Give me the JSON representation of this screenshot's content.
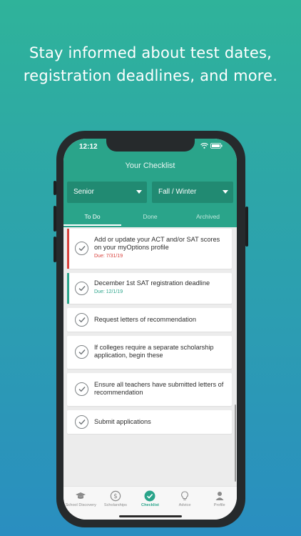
{
  "headline": {
    "line1": "Stay informed about test dates,",
    "line2": "registration deadlines, and more."
  },
  "status_bar": {
    "time": "12:12"
  },
  "header": {
    "title": "Your Checklist"
  },
  "filters": {
    "grade": {
      "value": "Senior"
    },
    "term": {
      "value": "Fall / Winter"
    }
  },
  "tabs": [
    {
      "label": "To Do",
      "active": true
    },
    {
      "label": "Done",
      "active": false
    },
    {
      "label": "Archived",
      "active": false
    }
  ],
  "tasks": [
    {
      "title": "Add or update your ACT and/or SAT scores on your myOptions profile",
      "due": "Due: 7/31/19",
      "status": "overdue"
    },
    {
      "title": "December 1st SAT registration deadline",
      "due": "Due: 12/1/19",
      "status": "upcoming"
    },
    {
      "title": "Request letters of recommendation",
      "due": "",
      "status": "none"
    },
    {
      "title": "If colleges require a separate scholarship application, begin these",
      "due": "",
      "status": "none"
    },
    {
      "title": "Ensure all teachers have submitted letters of recommendation",
      "due": "",
      "status": "none"
    },
    {
      "title": "Submit applications",
      "due": "",
      "status": "none"
    }
  ],
  "bottom_nav": [
    {
      "label": "School Discovery",
      "icon": "graduation-cap-icon"
    },
    {
      "label": "Scholarships",
      "icon": "dollar-circle-icon"
    },
    {
      "label": "Checklist",
      "icon": "checkmark-circle-icon",
      "active": true
    },
    {
      "label": "Advice",
      "icon": "lightbulb-icon"
    },
    {
      "label": "Profile",
      "icon": "person-icon"
    }
  ],
  "colors": {
    "brand": "#2aa48a",
    "overdue": "#d9413c",
    "upcoming": "#2aa48a"
  }
}
